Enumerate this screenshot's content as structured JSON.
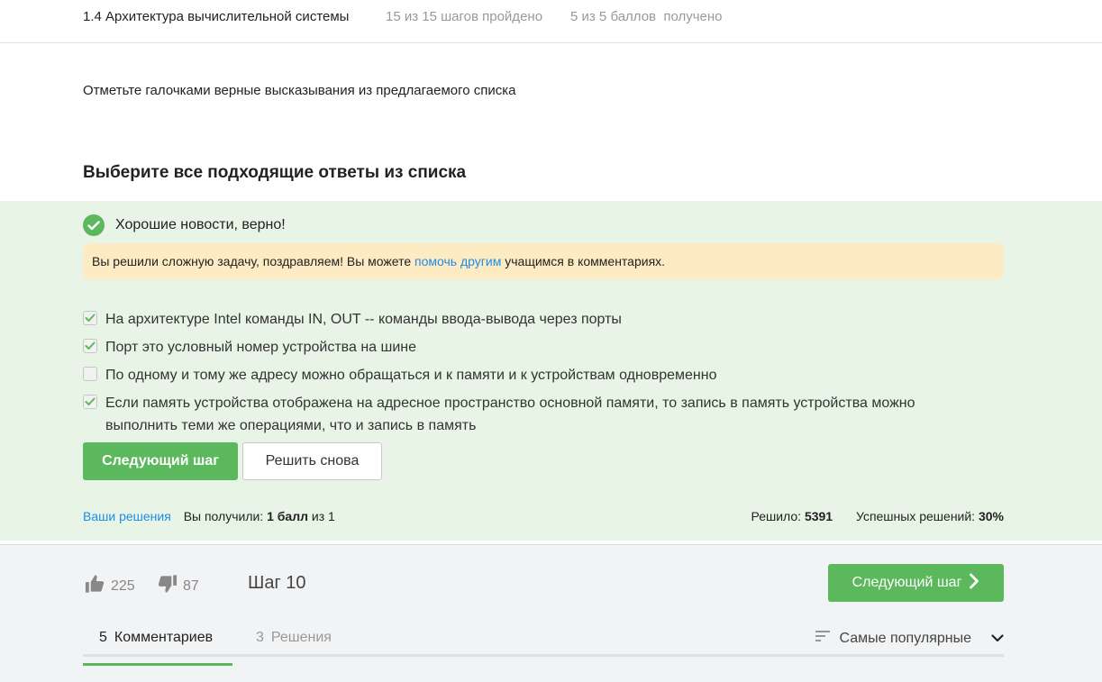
{
  "header": {
    "lesson_title": "1.4 Архитектура вычислительной системы",
    "steps_progress": "15 из 15 шагов пройдено",
    "points_progress": "5 из 5 баллов  получено"
  },
  "instruction": "Отметьте галочками верные высказывания из предлагаемого списка",
  "question_title": "Выберите все подходящие ответы из списка",
  "result": {
    "correct_message": "Хорошие новости, верно!",
    "notice_prefix": "Вы решили сложную задачу, поздравляем! Вы можете ",
    "notice_link": "помочь другим",
    "notice_suffix": " учащимся в комментариях."
  },
  "options": [
    {
      "text": "На архитектуре Intel команды IN, OUT -- команды ввода-вывода через порты",
      "checked": true
    },
    {
      "text": "Порт это условный номер устройства на шине",
      "checked": true
    },
    {
      "text": "По одному и тому же адресу можно обращаться и к памяти и к устройствам одновременно",
      "checked": false
    },
    {
      "text": "Если память устройства отображена на адресное пространство основной памяти, то запись в память устройства можно выполнить теми же операциями, что и запись в память",
      "checked": true
    }
  ],
  "buttons": {
    "next_step": "Следующий шаг",
    "retry": "Решить снова"
  },
  "stats": {
    "your_solutions": "Ваши решения",
    "got_prefix": "Вы получили:",
    "got_score": "1 балл",
    "got_suffix": "из 1",
    "solved_label": "Решило:",
    "solved_count": "5391",
    "success_label": "Успешных решений:",
    "success_rate": "30%"
  },
  "footer": {
    "likes": "225",
    "dislikes": "87",
    "step_label": "Шаг 10",
    "next_step": "Следующий шаг"
  },
  "tabs": [
    {
      "count": "5",
      "label": "Комментариев"
    },
    {
      "count": "3",
      "label": "Решения"
    }
  ],
  "sort": {
    "label": "Самые популярные"
  },
  "colors": {
    "accent": "#5cb85c",
    "link": "#1f8ce5",
    "notice_bg": "#fdebc3",
    "panel_bg": "#e8f5e6"
  }
}
